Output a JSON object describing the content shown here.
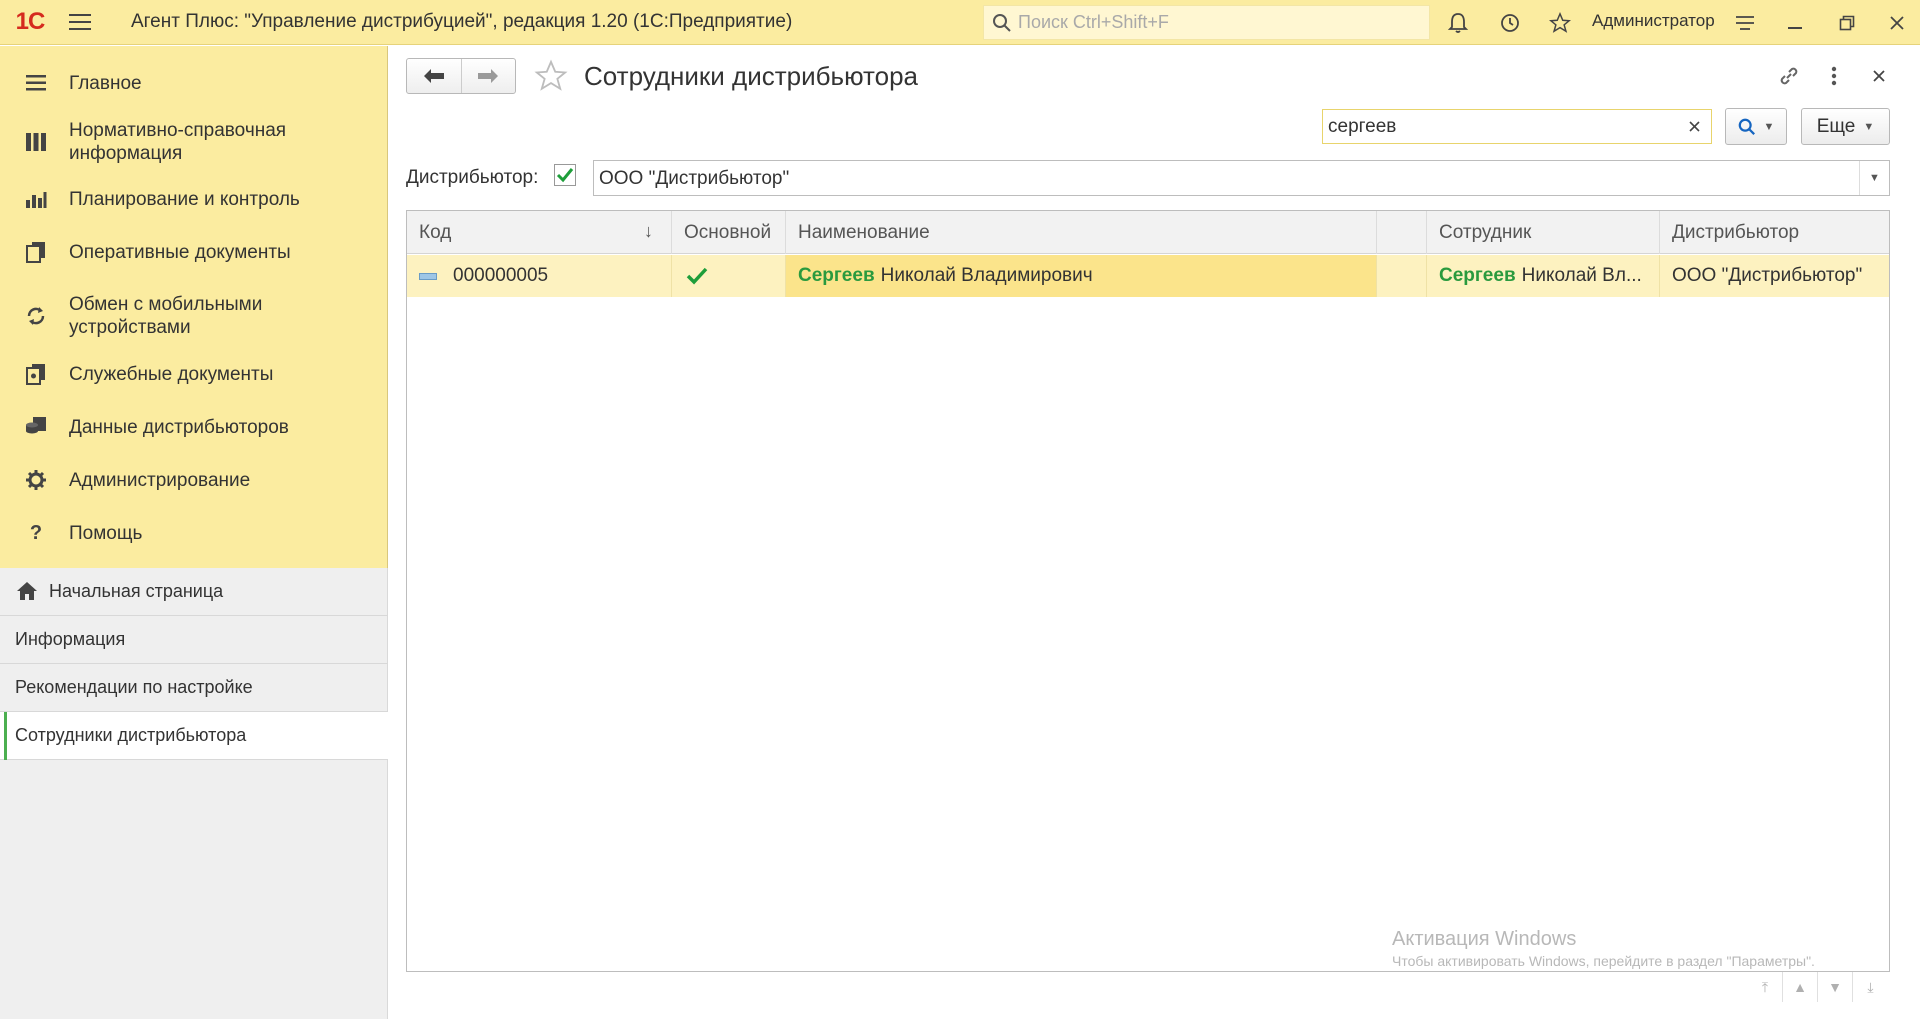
{
  "titlebar": {
    "logo": "1С",
    "title": "Агент Плюс: \"Управление дистрибуцией\", редакция 1.20  (1С:Предприятие)",
    "search_placeholder": "Поиск Ctrl+Shift+F",
    "user": "Администратор"
  },
  "sidebar": {
    "items": [
      {
        "label": "Главное",
        "icon": "menu-list-icon"
      },
      {
        "label": "Нормативно-справочная информация",
        "icon": "catalog-icon"
      },
      {
        "label": "Планирование и контроль",
        "icon": "bar-chart-icon"
      },
      {
        "label": "Оперативные документы",
        "icon": "documents-icon"
      },
      {
        "label": "Обмен с мобильными устройствами",
        "icon": "sync-icon"
      },
      {
        "label": "Служебные документы",
        "icon": "service-docs-icon"
      },
      {
        "label": "Данные дистрибьюторов",
        "icon": "distributor-data-icon"
      },
      {
        "label": "Администрирование",
        "icon": "gear-icon"
      },
      {
        "label": "Помощь",
        "icon": "help-icon"
      }
    ],
    "open_windows": [
      {
        "label": "Начальная страница",
        "icon": "home-icon"
      },
      {
        "label": "Информация"
      },
      {
        "label": "Рекомендации по настройке"
      },
      {
        "label": "Сотрудники дистрибьютора"
      }
    ]
  },
  "form": {
    "title": "Сотрудники дистрибьютора",
    "search_value": "сергеев",
    "more_label": "Еще",
    "filter_label": "Дистрибьютор:",
    "filter_value": "ООО \"Дистрибьютор\"",
    "filter_checked": true
  },
  "table": {
    "columns": [
      "Код",
      "Основной",
      "Наименование",
      "",
      "Сотрудник",
      "Дистрибьютор"
    ],
    "rows": [
      {
        "code": "000000005",
        "main": true,
        "name_highlight": "Сергеев",
        "name_rest": "Николай Владимирович",
        "employee_highlight": "Сергеев",
        "employee_rest": "Николай Вл...",
        "distributor": "ООО \"Дистрибьютор\""
      }
    ]
  },
  "watermark": {
    "line1": "Активация Windows",
    "line2": "Чтобы активировать Windows, перейдите в раздел \"Параметры\"."
  },
  "colors": {
    "accent_yellow": "#fbeca0",
    "highlight_green": "#2a9a3e",
    "selected_row": "#fdf2c0"
  }
}
